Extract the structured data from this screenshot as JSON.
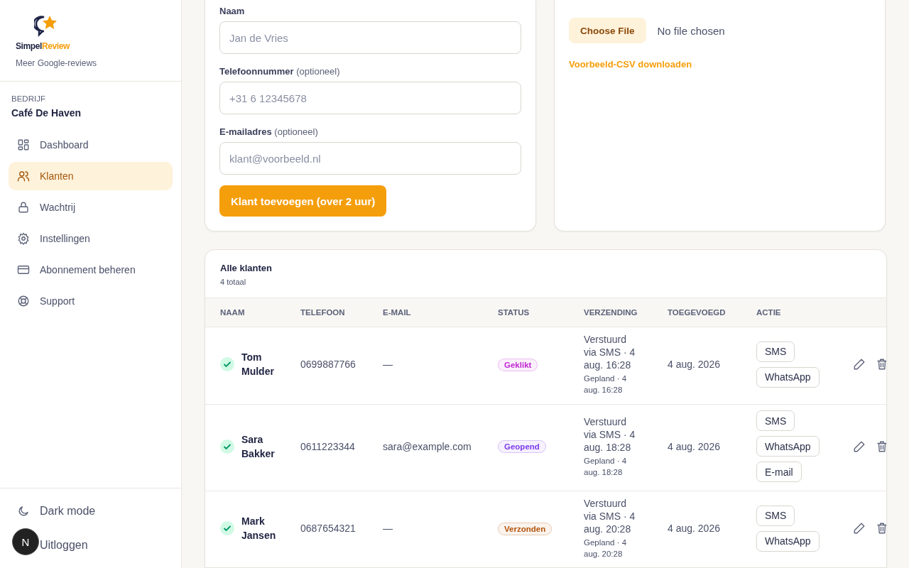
{
  "sidebar": {
    "brand": {
      "name_dark": "Simpel",
      "name_accent": "Review",
      "tagline": "Meer Google-reviews"
    },
    "company": {
      "label": "BEDRIJF",
      "name": "Café De Haven"
    },
    "items": [
      {
        "label": "Dashboard",
        "selected": false
      },
      {
        "label": "Klanten",
        "selected": true
      },
      {
        "label": "Wachtrij",
        "selected": false
      },
      {
        "label": "Instellingen",
        "selected": false
      },
      {
        "label": "Abonnement beheren",
        "selected": false
      },
      {
        "label": "Support",
        "selected": false
      }
    ],
    "footer": [
      {
        "label": "Dark mode"
      },
      {
        "label": "Uitloggen"
      }
    ]
  },
  "dev_badge": "N",
  "form": {
    "fields": [
      {
        "label": "Naam",
        "placeholder": "Jan de Vries"
      },
      {
        "label": "Telefoonnummer",
        "hint": "(optioneel)",
        "placeholder": "+31 6 12345678"
      },
      {
        "label": "E-mailadres",
        "hint": "(optioneel)",
        "placeholder": "klant@voorbeeld.nl"
      }
    ],
    "submit": "Klant toevoegen (over 2 uur)"
  },
  "upload": {
    "button": "Choose File",
    "file_status": "No file chosen",
    "link": "Voorbeeld-CSV downloaden"
  },
  "table": {
    "title": "Alle klanten",
    "count": "4 totaal",
    "columns": [
      "NAAM",
      "TELEFOON",
      "E-MAIL",
      "STATUS",
      "VERZENDING",
      "TOEGEVOEGD",
      "ACTIE"
    ],
    "rows": [
      {
        "done": true,
        "name": "Tom Mulder",
        "phone": "0699887766",
        "email": "—",
        "status": {
          "label": "Geklikt",
          "color": "#c026d3"
        },
        "sent": "Verstuurd via SMS · 4 aug. 16:28",
        "planned": "Gepland · 4 aug. 16:28",
        "added": "4 aug. 2026",
        "actions": [
          "SMS",
          "WhatsApp"
        ]
      },
      {
        "done": true,
        "name": "Sara Bakker",
        "phone": "0611223344",
        "email": "sara@example.com",
        "status": {
          "label": "Geopend",
          "color": "#7c3aed"
        },
        "sent": "Verstuurd via SMS · 4 aug. 18:28",
        "planned": "Gepland · 4 aug. 18:28",
        "added": "4 aug. 2026",
        "actions": [
          "SMS",
          "WhatsApp",
          "E-mail"
        ]
      },
      {
        "done": true,
        "name": "Mark Jansen",
        "phone": "0687654321",
        "email": "—",
        "status": {
          "label": "Verzonden",
          "color": "#b45309"
        },
        "sent": "Verstuurd via SMS · 4 aug. 20:28",
        "planned": "Gepland · 4 aug. 20:28",
        "added": "4 aug. 2026",
        "actions": [
          "SMS",
          "WhatsApp"
        ]
      }
    ]
  }
}
